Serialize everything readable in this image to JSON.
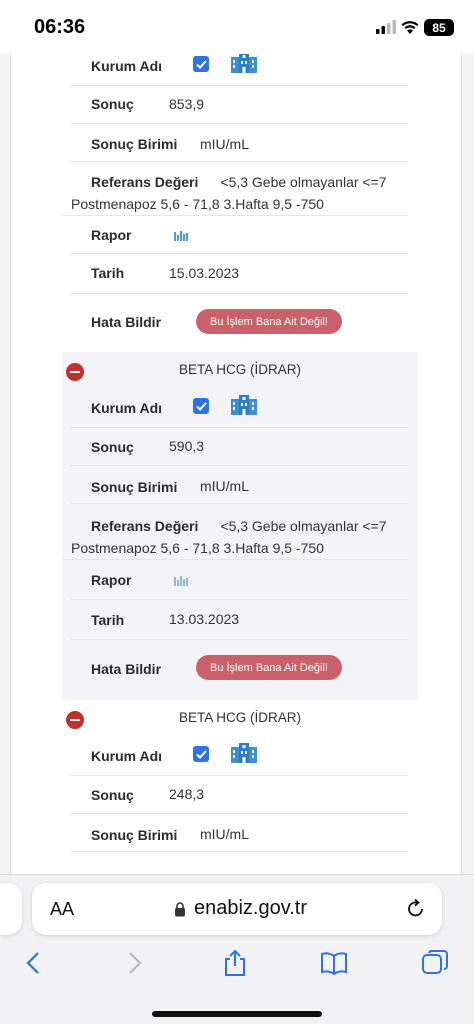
{
  "status_bar": {
    "time": "06:36",
    "battery": "85"
  },
  "labels": {
    "institution": "Kurum Adı",
    "result": "Sonuç",
    "unit": "Sonuç Birimi",
    "reference": "Referans Değeri",
    "report": "Rapor",
    "date": "Tarih",
    "report_error": "Hata Bildir"
  },
  "records": [
    {
      "title": "",
      "result": "853,9",
      "unit": "mIU/mL",
      "reference_line1": "<5,3 Gebe olmayanlar <=7",
      "reference_line2": "Postmenapoz 5,6 - 71,8 3.Hafta 9,5 -750",
      "date": "15.03.2023",
      "error_button": "Bu İşlem Bana Ait Değil!"
    },
    {
      "title": "BETA HCG (İDRAR)",
      "result": "590,3",
      "unit": "mIU/mL",
      "reference_line1": "<5,3 Gebe olmayanlar <=7",
      "reference_line2": "Postmenapoz 5,6 - 71,8 3.Hafta 9,5 -750",
      "date": "13.03.2023",
      "error_button": "Bu İşlem Bana Ait Değil!"
    },
    {
      "title": "BETA HCG (İDRAR)",
      "result": "248,3",
      "unit": "mIU/mL"
    }
  ],
  "browser": {
    "text_size_label": "AA",
    "domain": "enabiz.gov.tr"
  },
  "colors": {
    "accent_blue": "#2f73e0",
    "error_button": "#c9606a",
    "collapse_icon": "#c0322f"
  }
}
